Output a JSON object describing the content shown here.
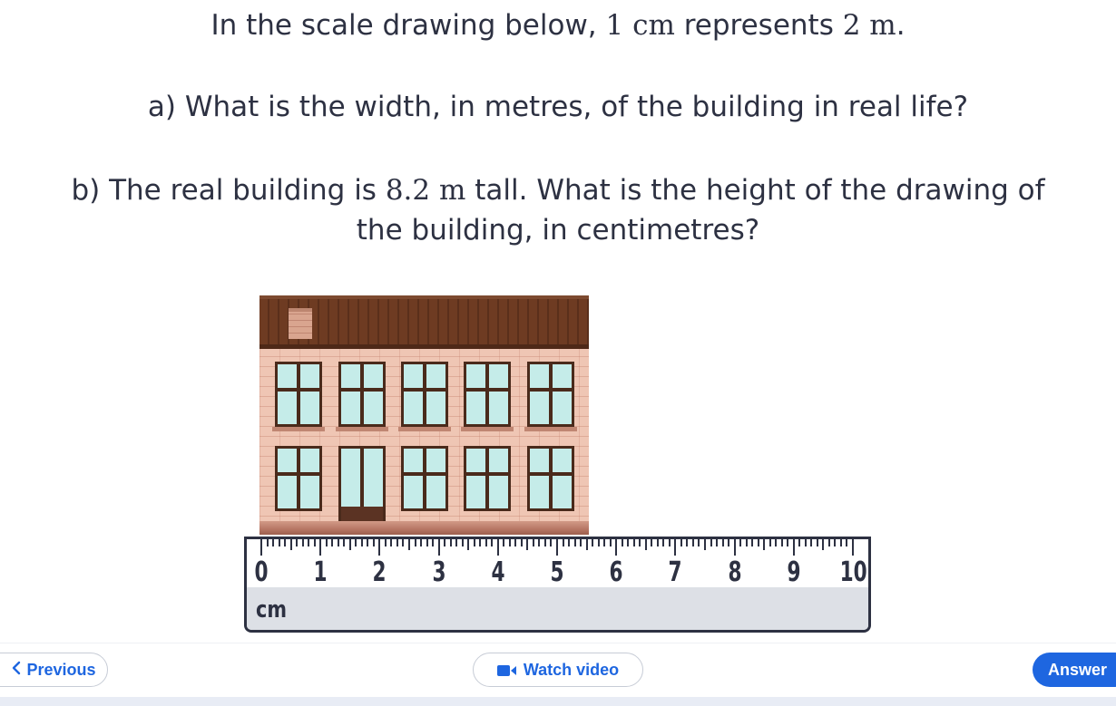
{
  "question": {
    "intro_pre": "In the scale drawing below, ",
    "intro_scale_drawing": "1 cm",
    "intro_mid": " represents ",
    "intro_scale_real": "2 m",
    "intro_post": ".",
    "part_a": "a) What is the width, in metres, of the building in real life?",
    "part_b_pre": "b) The real building is ",
    "part_b_height": "8.2 m",
    "part_b_post": " tall. What is the height of the drawing of",
    "part_b_line2": "the building, in centimetres?"
  },
  "ruler": {
    "labels": [
      "0",
      "1",
      "2",
      "3",
      "4",
      "5",
      "6",
      "7",
      "8",
      "9",
      "10"
    ],
    "unit": "cm"
  },
  "nav": {
    "previous_label": "Previous",
    "video_label": "Watch video",
    "answer_label": "Answer"
  },
  "colors": {
    "accent": "#1e66e0",
    "text": "#2d3142",
    "roof": "#6e3b22",
    "wall": "#efc6b4",
    "window_glass": "#c5ece9"
  },
  "icons": {
    "previous": "chevron-left-icon",
    "video": "video-camera-icon"
  }
}
